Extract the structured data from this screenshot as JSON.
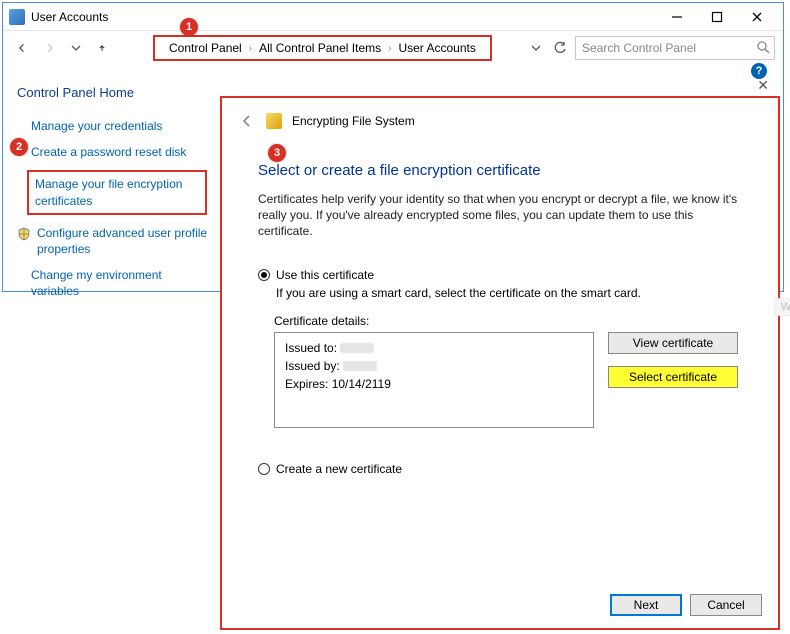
{
  "window": {
    "title": "User Accounts",
    "minimize_glyph": "—",
    "maximize_glyph": "▢",
    "close_glyph": "✕"
  },
  "breadcrumb": {
    "items": [
      "Control Panel",
      "All Control Panel Items",
      "User Accounts"
    ],
    "sep": "›"
  },
  "search": {
    "placeholder": "Search Control Panel"
  },
  "help_badge": "?",
  "sidebar": {
    "home": "Control Panel Home",
    "links": {
      "credentials": "Manage your credentials",
      "reset_disk": "Create a password reset disk",
      "file_enc": "Manage your file encryption certificates",
      "adv_profile": "Configure advanced user profile properties",
      "env_vars": "Change my environment variables"
    }
  },
  "steps": {
    "s1": "1",
    "s2": "2",
    "s3": "3"
  },
  "wizard": {
    "header": "Encrypting File System",
    "heading": "Select or create a file encryption certificate",
    "desc": "Certificates help verify your identity so that when you encrypt or decrypt a file, we know it's really you. If you've already encrypted some files, you can update them to use this certificate.",
    "opt_use": "Use this certificate",
    "opt_use_sub": "If you are using a smart card, select the certificate on the smart card.",
    "cert_details_label": "Certificate details:",
    "cert": {
      "issued_to_label": "Issued to:",
      "issued_by_label": "Issued by:",
      "expires_label": "Expires:",
      "expires_value": "10/14/2119"
    },
    "btn_view": "View certificate",
    "btn_select": "Select certificate",
    "opt_create": "Create a new certificate",
    "btn_next": "Next",
    "btn_cancel": "Cancel"
  },
  "windowsnip": "Window Sni"
}
